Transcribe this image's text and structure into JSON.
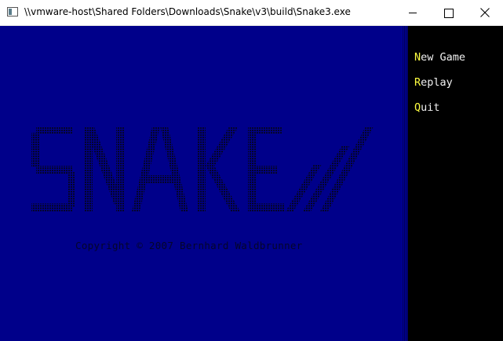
{
  "window": {
    "title": "\\\\vmware-host\\Shared Folders\\Downloads\\Snake\\v3\\build\\Snake3.exe"
  },
  "game": {
    "logo_text": "SNAKE ///",
    "copyright": "Copyright © 2007 Bernhard Waldbrunner",
    "colors": {
      "playfield": "#00008a",
      "sidebar": "#000000",
      "hotkey": "#ffff40",
      "menu_text": "#f2f2f2",
      "logo_dots": "#05052a"
    }
  },
  "menu": {
    "items": [
      {
        "hotkey": "N",
        "rest": "ew Game"
      },
      {
        "hotkey": "R",
        "rest": "eplay"
      },
      {
        "hotkey": "Q",
        "rest": "uit"
      }
    ]
  }
}
